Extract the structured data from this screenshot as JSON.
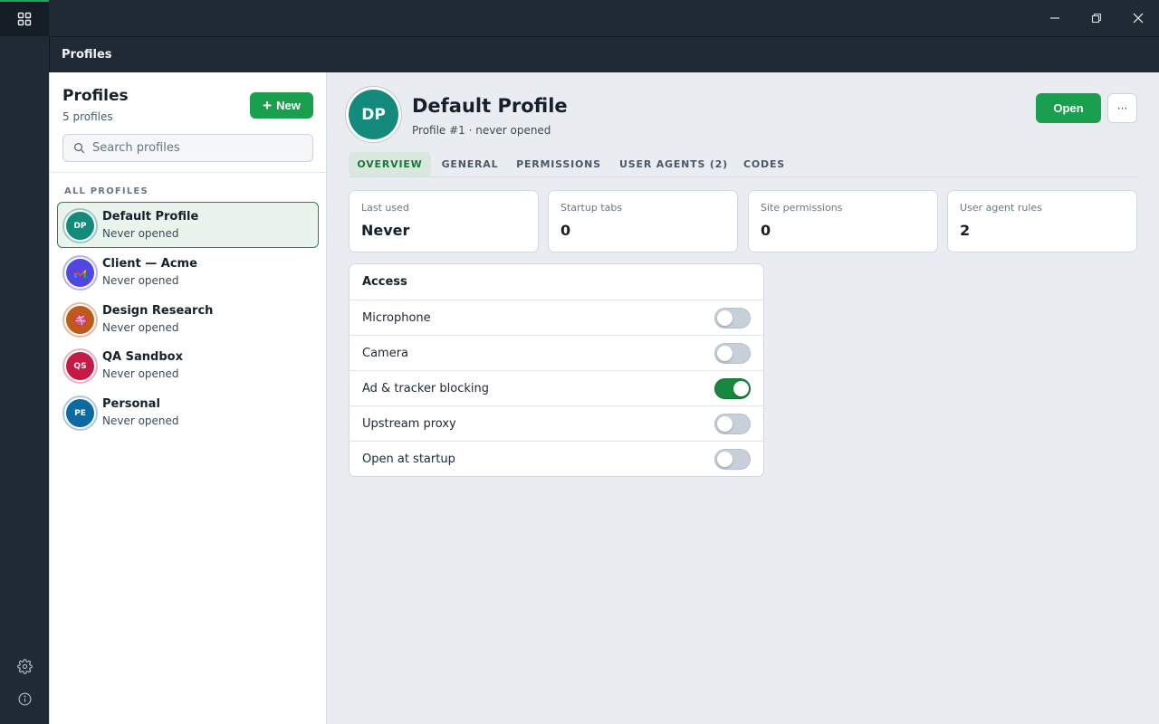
{
  "header": {
    "title": "Profiles"
  },
  "sidebar": {
    "title": "Profiles",
    "count": "5 profiles",
    "new_label": "New",
    "search_placeholder": "Search profiles",
    "section_label": "ALL PROFILES",
    "profiles": [
      {
        "name": "Default Profile",
        "sub": "Never opened",
        "initials": "DP",
        "color": "#138a7b",
        "ring": "#9fcbc0",
        "icon": "initials"
      },
      {
        "name": "Client — Acme",
        "sub": "Never opened",
        "initials": "",
        "color": "#4f46e5",
        "ring": "#b7b3ee",
        "icon": "gmail-icon"
      },
      {
        "name": "Design Research",
        "sub": "Never opened",
        "initials": "",
        "color": "#c05a1a",
        "ring": "#e3bda3",
        "icon": "dribbble-icon"
      },
      {
        "name": "QA Sandbox",
        "sub": "Never opened",
        "initials": "QS",
        "color": "#c41a45",
        "ring": "#eeb0c1",
        "icon": "initials"
      },
      {
        "name": "Personal",
        "sub": "Never opened",
        "initials": "PE",
        "color": "#0c6aa3",
        "ring": "#a8cbe1",
        "icon": "initials"
      }
    ]
  },
  "main": {
    "avatar_initials": "DP",
    "title": "Default Profile",
    "subtitle": "Profile #1 · never opened",
    "open_label": "Open",
    "more_label": "···",
    "tabs": [
      {
        "label": "OVERVIEW",
        "active": true
      },
      {
        "label": "GENERAL",
        "active": false
      },
      {
        "label": "PERMISSIONS",
        "active": false
      },
      {
        "label": "USER AGENTS (2)",
        "active": false
      },
      {
        "label": "CODES",
        "active": false
      }
    ],
    "stats": [
      {
        "label": "Last used",
        "value": "Never"
      },
      {
        "label": "Startup tabs",
        "value": "0"
      },
      {
        "label": "Site permissions",
        "value": "0"
      },
      {
        "label": "User agent rules",
        "value": "2"
      }
    ],
    "access": {
      "title": "Access",
      "rows": [
        {
          "label": "Microphone",
          "on": false
        },
        {
          "label": "Camera",
          "on": false
        },
        {
          "label": "Ad & tracker blocking",
          "on": true
        },
        {
          "label": "Upstream proxy",
          "on": false
        },
        {
          "label": "Open at startup",
          "on": false
        }
      ]
    }
  },
  "colors": {
    "accent": "#1a9f4f",
    "chrome": "#1f2a35"
  }
}
